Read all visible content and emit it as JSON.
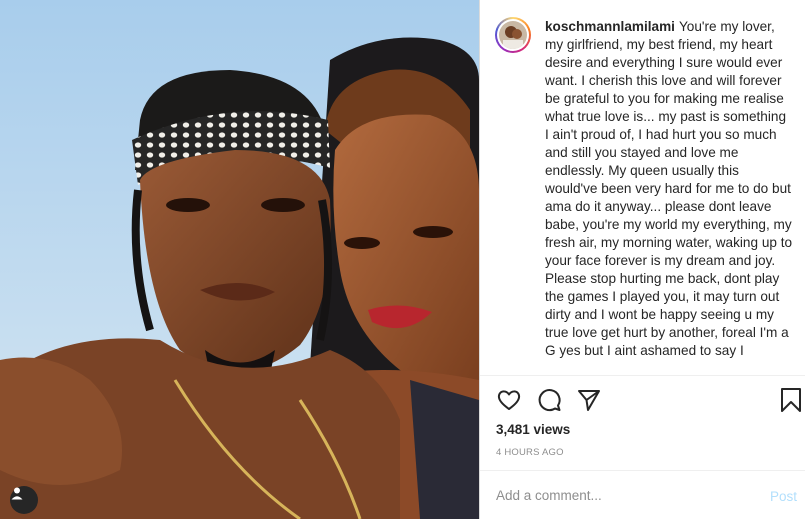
{
  "post": {
    "username": "koschmannlamilami",
    "caption": "You're my lover, my girlfriend, my best friend, my heart desire and everything I sure would ever want. I cherish this love and will forever be grateful to you for making me realise what true love is... my past is something I ain't proud of, I had hurt you so much and still you stayed and love me endlessly. My queen usually this would've been very hard for me to do but ama do it anyway... please dont leave babe, you're my world my everything, my fresh air, my morning water, waking up to your face forever is my dream and joy. Please stop hurting me back, dont play the games I played you, it may turn out dirty and I wont be happy seeing u my true love get hurt by another, foreal I'm a G yes but I aint ashamed to say I",
    "views": "3,481 views",
    "timestamp": "4 HOURS AGO"
  },
  "comment": {
    "placeholder": "Add a comment...",
    "post_label": "Post"
  },
  "icons": {
    "like": "heart-icon",
    "comment": "comment-icon",
    "share": "share-icon",
    "save": "bookmark-icon",
    "tags": "user-tag-icon"
  },
  "colors": {
    "post_button": "#b2dffc",
    "muted": "#8e8e8e",
    "text": "#262626"
  }
}
